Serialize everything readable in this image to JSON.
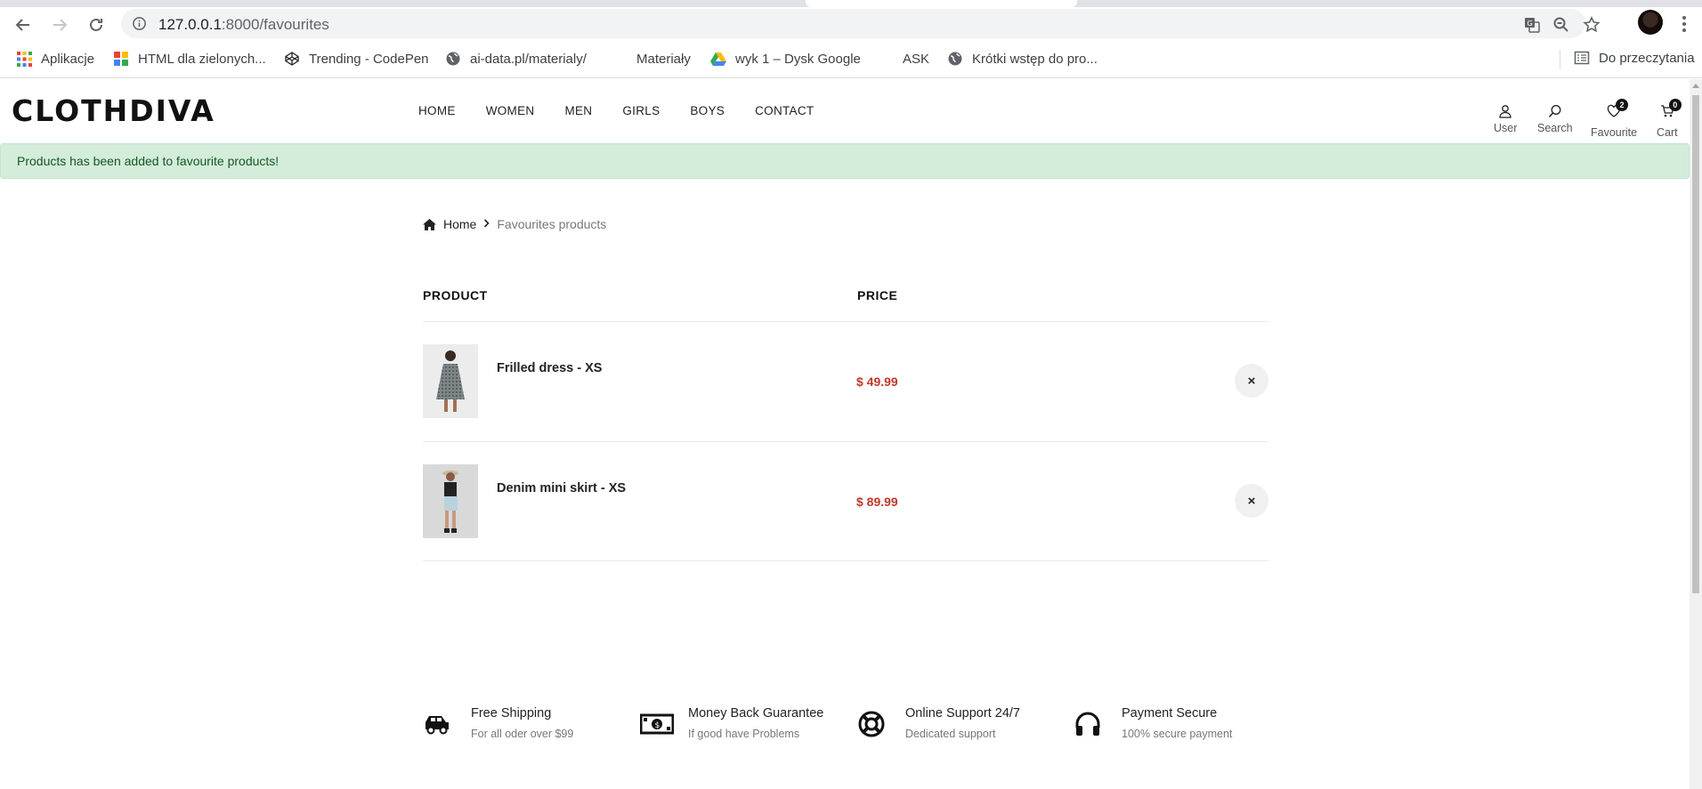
{
  "browser": {
    "url_host": "127.0.0.1",
    "url_path": ":8000/favourites",
    "bookmarks": [
      {
        "label": "Aplikacje",
        "icon": "apps-grid-icon"
      },
      {
        "label": "HTML dla zielonych...",
        "icon": "site-favicon-icon"
      },
      {
        "label": "Trending - CodePen",
        "icon": "codepen-icon"
      },
      {
        "label": "ai-data.pl/materialy/",
        "icon": "globe-icon"
      },
      {
        "label": "Materiały",
        "icon": "blank-icon"
      },
      {
        "label": "wyk 1 – Dysk Google",
        "icon": "google-drive-icon"
      },
      {
        "label": "ASK",
        "icon": "blank-icon"
      },
      {
        "label": "Krótki wstęp do pro...",
        "icon": "globe-icon"
      }
    ],
    "reading_list": "Do przeczytania"
  },
  "site": {
    "logo": "CLOTHDIVA",
    "menu": [
      "HOME",
      "WOMEN",
      "MEN",
      "GIRLS",
      "BOYS",
      "CONTACT"
    ],
    "icons": {
      "user": "User",
      "search": "Search",
      "favourite": "Favourite",
      "favourite_count": "2",
      "cart": "Cart",
      "cart_count": "0"
    }
  },
  "alert": "Products has been added to favourite products!",
  "breadcrumb": {
    "home": "Home",
    "current": "Favourites products"
  },
  "table": {
    "headers": {
      "product": "PRODUCT",
      "price": "PRICE"
    },
    "rows": [
      {
        "name": "Frilled dress - XS",
        "price": "$ 49.99",
        "remove": "×"
      },
      {
        "name": "Denim mini skirt - XS",
        "price": "$ 89.99",
        "remove": "×"
      }
    ]
  },
  "services": [
    {
      "title": "Free Shipping",
      "subtitle": "For all oder over $99",
      "icon": "truck-icon"
    },
    {
      "title": "Money Back Guarantee",
      "subtitle": "If good have Problems",
      "icon": "money-icon"
    },
    {
      "title": "Online Support 24/7",
      "subtitle": "Dedicated support",
      "icon": "lifebuoy-icon"
    },
    {
      "title": "Payment Secure",
      "subtitle": "100% secure payment",
      "icon": "headphones-icon"
    }
  ],
  "colors": {
    "alert_bg": "#d4edda",
    "alert_text": "#155724",
    "price": "#c0392b"
  }
}
